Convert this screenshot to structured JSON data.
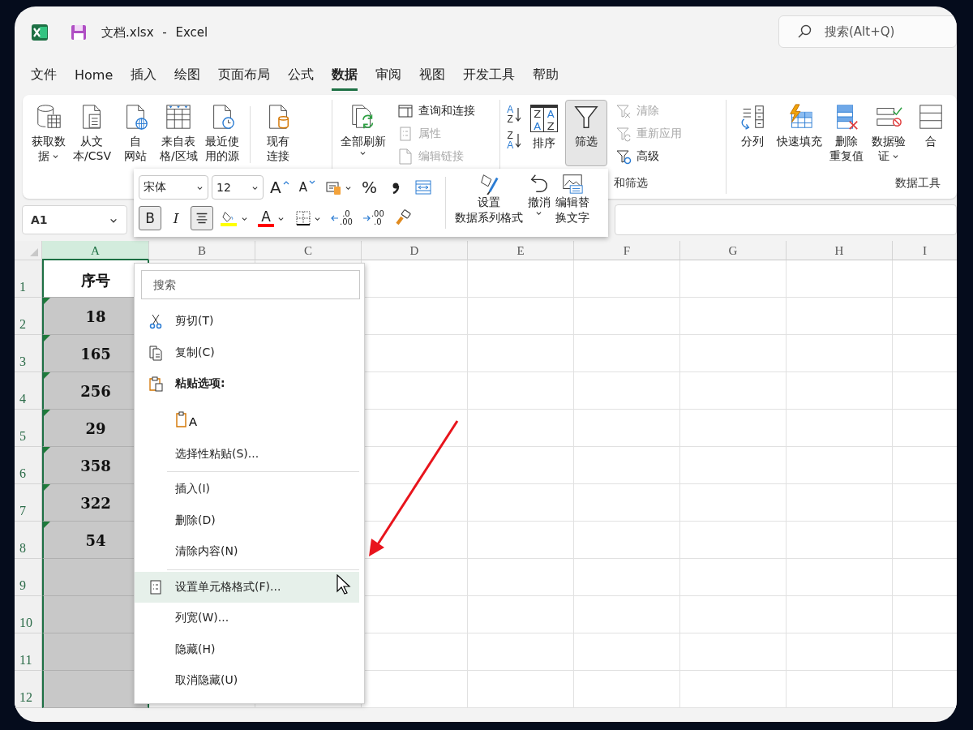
{
  "window": {
    "title": "文档.xlsx - Excel"
  },
  "search": {
    "placeholder": "搜索(Alt+Q)"
  },
  "menu_tabs": [
    {
      "label": "文件",
      "selected": false
    },
    {
      "label": "Home",
      "selected": false
    },
    {
      "label": "插入",
      "selected": false
    },
    {
      "label": "绘图",
      "selected": false
    },
    {
      "label": "页面布局",
      "selected": false
    },
    {
      "label": "公式",
      "selected": false
    },
    {
      "label": "数据",
      "selected": true
    },
    {
      "label": "审阅",
      "selected": false
    },
    {
      "label": "视图",
      "selected": false
    },
    {
      "label": "开发工具",
      "selected": false
    },
    {
      "label": "帮助",
      "selected": false
    }
  ],
  "ribbon": {
    "groups": [
      {
        "controls": [
          {
            "kind": "get-data",
            "lines": [
              "获取数",
              "据"
            ],
            "caret": true,
            "pressed": false
          },
          {
            "kind": "from-text",
            "lines": [
              "从文",
              "本/CSV"
            ],
            "pressed": false
          },
          {
            "kind": "from-web",
            "lines": [
              "自",
              "网站"
            ],
            "pressed": false
          },
          {
            "kind": "from-table",
            "lines": [
              "来自表",
              "格/区域"
            ],
            "pressed": false
          },
          {
            "kind": "recent-sources",
            "lines": [
              "最近使",
              "用的源"
            ],
            "pressed": false
          },
          {
            "kind": "existing-connections",
            "lines": [
              "现有",
              "连接"
            ],
            "pressed": false,
            "divider_before": true
          }
        ]
      },
      {
        "controls": [
          {
            "kind": "refresh-all",
            "lines": [
              "全部刷新"
            ],
            "caret": true,
            "pressed": false
          },
          {
            "kind": "stack",
            "buttons": [
              {
                "kind": "queries",
                "label": "查询和连接",
                "disabled": false
              },
              {
                "kind": "properties",
                "label": "属性",
                "disabled": true
              },
              {
                "kind": "edit-links",
                "label": "编辑链接",
                "disabled": true
              }
            ]
          }
        ]
      },
      {
        "label": "和筛选",
        "controls": [
          {
            "kind": "sort-stack",
            "buttons": [
              {
                "kind": "sort-asc",
                "glyphs": [
                  "A",
                  "Z"
                ]
              },
              {
                "kind": "sort-desc",
                "glyphs": [
                  "Z",
                  "A"
                ]
              }
            ]
          },
          {
            "kind": "sort",
            "glyphs": [
              "Z",
              "A",
              "A",
              "Z"
            ],
            "lines": [
              "排序"
            ],
            "pressed": false
          },
          {
            "kind": "filter",
            "lines": [
              "筛选"
            ],
            "pressed": true
          },
          {
            "kind": "stack",
            "buttons": [
              {
                "kind": "clear",
                "label": "清除",
                "disabled": true
              },
              {
                "kind": "reapply",
                "label": "重新应用",
                "disabled": true
              },
              {
                "kind": "advanced",
                "label": "高级",
                "disabled": false
              }
            ]
          }
        ]
      },
      {
        "label": "数据工具",
        "controls": [
          {
            "kind": "text-to-columns",
            "lines": [
              "分列"
            ],
            "pressed": false
          },
          {
            "kind": "flash-fill",
            "lines": [
              "快速填充"
            ],
            "pressed": false
          },
          {
            "kind": "remove-duplicates",
            "lines": [
              "删除",
              "重复值"
            ],
            "pressed": false
          },
          {
            "kind": "data-validation",
            "lines": [
              "数据验",
              "证"
            ],
            "caret": true,
            "pressed": false
          },
          {
            "kind": "consolidate",
            "lines": [
              "合"
            ],
            "pressed": false
          }
        ]
      }
    ]
  },
  "name_box": "A1",
  "mini_toolbar": {
    "font": "宋体",
    "size": "12",
    "row1": [
      {
        "kind": "grow-font",
        "glyph": "A"
      },
      {
        "kind": "shrink-font",
        "glyph": "A"
      },
      {
        "kind": "number-format"
      },
      {
        "kind": "percent",
        "glyph": "%"
      },
      {
        "kind": "comma"
      },
      {
        "kind": "wrap"
      }
    ],
    "row2": [
      {
        "kind": "bold",
        "glyph": "B",
        "pressed": true
      },
      {
        "kind": "italic",
        "glyph": "I",
        "pressed": false
      },
      {
        "kind": "center",
        "pressed": true
      },
      {
        "kind": "fill-color",
        "color": "#ffff00"
      },
      {
        "kind": "font-color",
        "glyph": "A",
        "color": "#ff0000"
      },
      {
        "kind": "borders"
      },
      {
        "kind": "increase-decimal",
        "glyphs": [
          ".0",
          ".00"
        ]
      },
      {
        "kind": "decrease-decimal",
        "glyphs": [
          ".00",
          ".0"
        ]
      },
      {
        "kind": "format-painter"
      }
    ],
    "buttons": [
      {
        "kind": "format-series",
        "lines": [
          "设置",
          "数据系列格式"
        ]
      },
      {
        "kind": "undo",
        "lines": [
          "撤消"
        ],
        "caret": true
      },
      {
        "kind": "alt-text",
        "lines": [
          "编辑替",
          "换文字"
        ]
      }
    ]
  },
  "sheet": {
    "columns": [
      {
        "label": "A",
        "selected": true
      },
      {
        "label": "B",
        "selected": false
      },
      {
        "label": "C",
        "selected": false
      },
      {
        "label": "D",
        "selected": false
      },
      {
        "label": "E",
        "selected": false
      },
      {
        "label": "F",
        "selected": false
      },
      {
        "label": "G",
        "selected": false
      },
      {
        "label": "H",
        "selected": false
      },
      {
        "label": "I",
        "selected": false
      }
    ],
    "rows": [
      {
        "number": "1",
        "value": "序号",
        "active": true
      },
      {
        "number": "2",
        "value": "18",
        "active": false,
        "flag": true
      },
      {
        "number": "3",
        "value": "165",
        "active": false,
        "flag": true
      },
      {
        "number": "4",
        "value": "256",
        "active": false,
        "flag": true
      },
      {
        "number": "5",
        "value": "29",
        "active": false,
        "flag": true
      },
      {
        "number": "6",
        "value": "358",
        "active": false,
        "flag": true
      },
      {
        "number": "7",
        "value": "322",
        "active": false,
        "flag": true
      },
      {
        "number": "8",
        "value": "54",
        "active": false,
        "flag": true
      },
      {
        "number": "9",
        "active": false
      },
      {
        "number": "10",
        "active": false
      },
      {
        "number": "11",
        "active": false
      },
      {
        "number": "12",
        "active": false
      }
    ]
  },
  "context_menu": {
    "search": {
      "placeholder": "搜索"
    },
    "items": [
      {
        "kind": "cut",
        "label": "剪切(T)",
        "selected": false
      },
      {
        "kind": "copy",
        "label": "复制(C)",
        "selected": false
      },
      {
        "kind": "paste-header",
        "label": "粘贴选项:",
        "selected": false
      },
      {
        "kind": "paste-option",
        "glyph": "A",
        "selected": false
      },
      {
        "kind": "plain",
        "label": "选择性粘贴(S)...",
        "selected": false
      },
      {
        "kind": "plain",
        "label": "插入(I)",
        "selected": false,
        "divider_above": true
      },
      {
        "kind": "plain",
        "label": "删除(D)",
        "selected": false
      },
      {
        "kind": "plain",
        "label": "清除内容(N)",
        "selected": false
      },
      {
        "kind": "format-cells",
        "label": "设置单元格格式(F)...",
        "selected": true,
        "divider_above": true
      },
      {
        "kind": "plain",
        "label": "列宽(W)...",
        "selected": false
      },
      {
        "kind": "plain",
        "label": "隐藏(H)",
        "selected": false
      },
      {
        "kind": "plain",
        "label": "取消隐藏(U)",
        "selected": false
      }
    ]
  }
}
